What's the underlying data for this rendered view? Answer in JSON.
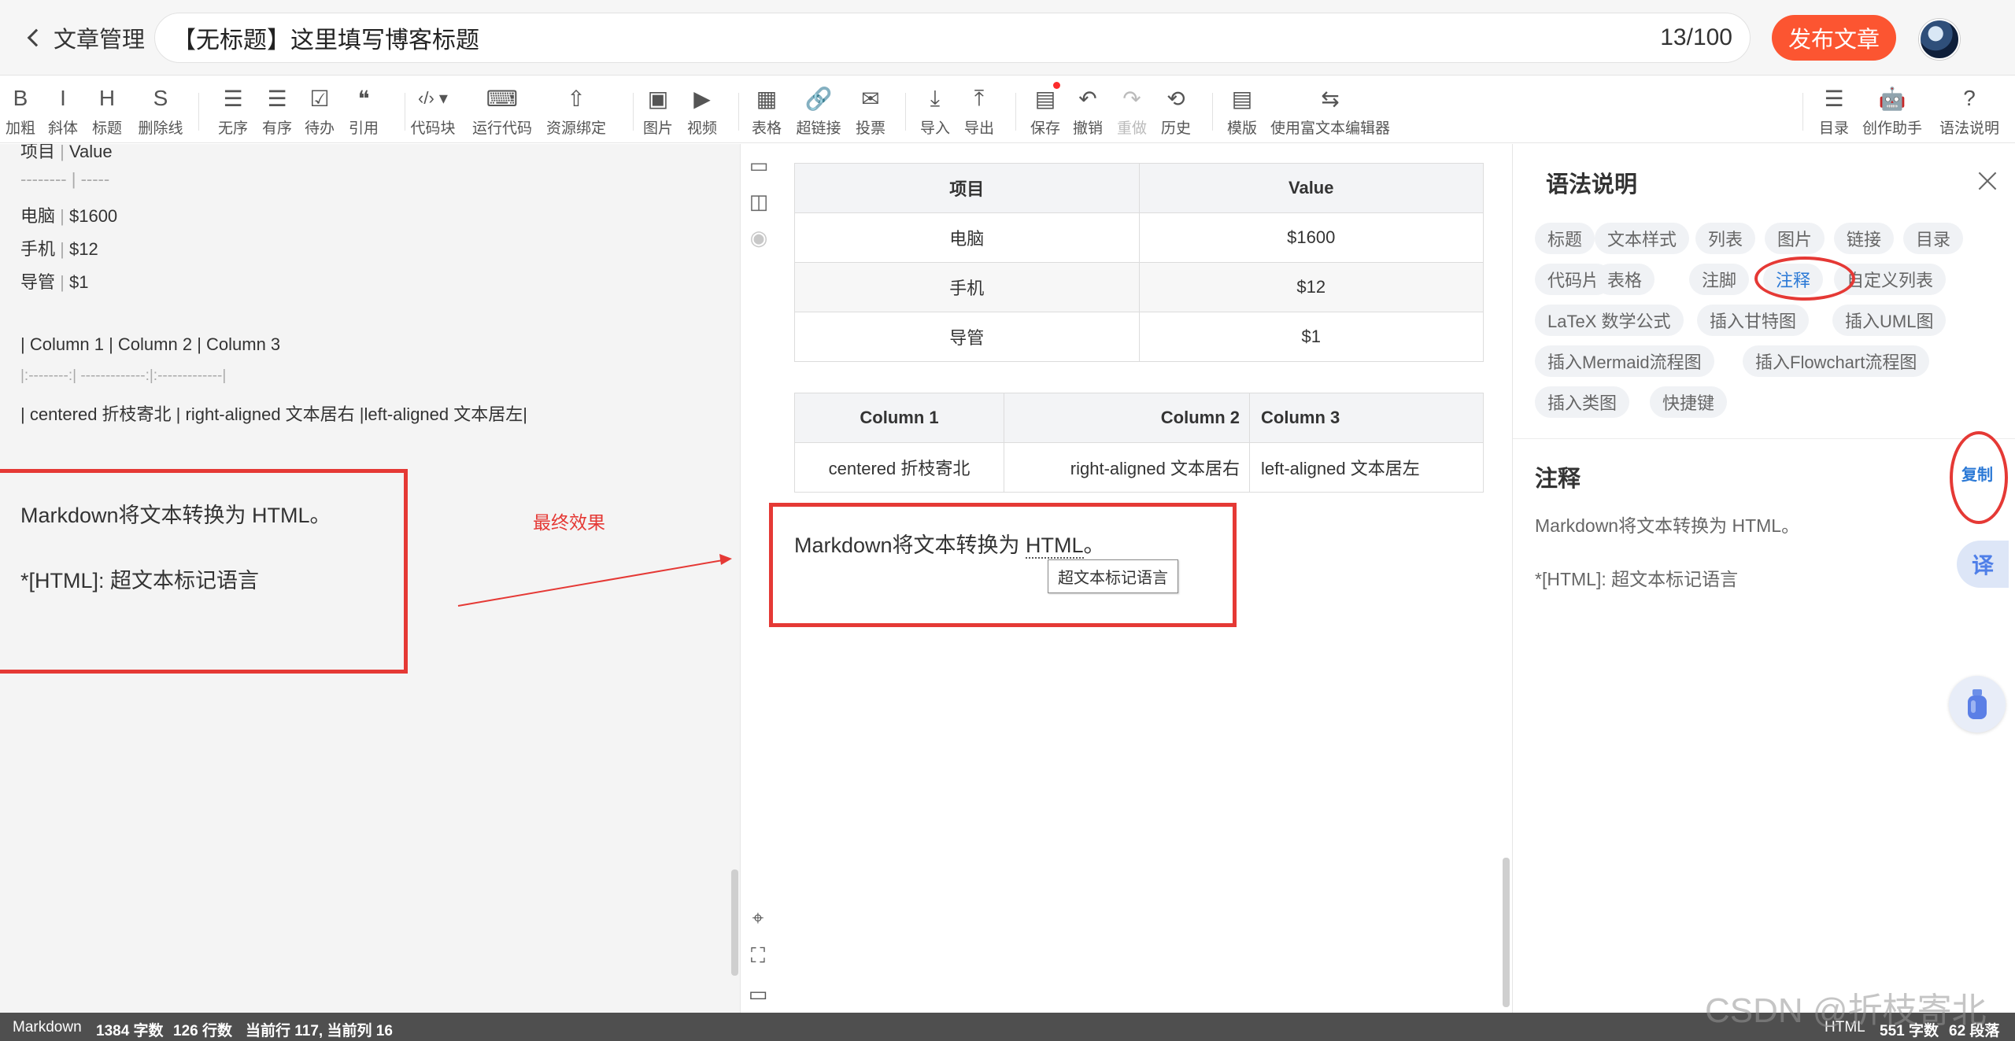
{
  "header": {
    "back_label": "文章管理",
    "title_value": "【无标题】这里填写博客标题",
    "title_count": "13/100",
    "publish_label": "发布文章"
  },
  "toolbar": {
    "items": [
      {
        "icon": "B",
        "label": "加粗",
        "icon_name": "bold-icon"
      },
      {
        "icon": "I",
        "label": "斜体",
        "icon_name": "italic-icon"
      },
      {
        "icon": "H",
        "label": "标题",
        "icon_name": "heading-icon"
      },
      {
        "icon": "S",
        "label": "删除线",
        "icon_name": "strikethrough-icon"
      },
      {
        "icon": "☰",
        "label": "无序",
        "icon_name": "unordered-list-icon"
      },
      {
        "icon": "☰",
        "label": "有序",
        "icon_name": "ordered-list-icon"
      },
      {
        "icon": "☑",
        "label": "待办",
        "icon_name": "todo-list-icon"
      },
      {
        "icon": "❝",
        "label": "引用",
        "icon_name": "quote-icon"
      },
      {
        "icon": "‹/›",
        "label": "代码块",
        "icon_name": "code-block-icon"
      },
      {
        "icon": "⌨",
        "label": "运行代码",
        "icon_name": "run-code-icon"
      },
      {
        "icon": "⇧",
        "label": "资源绑定",
        "icon_name": "resource-bind-icon"
      },
      {
        "icon": "▣",
        "label": "图片",
        "icon_name": "image-icon"
      },
      {
        "icon": "▶",
        "label": "视频",
        "icon_name": "video-icon"
      },
      {
        "icon": "▦",
        "label": "表格",
        "icon_name": "table-icon"
      },
      {
        "icon": "🔗",
        "label": "超链接",
        "icon_name": "link-icon"
      },
      {
        "icon": "✉",
        "label": "投票",
        "icon_name": "vote-icon"
      },
      {
        "icon": "⤓",
        "label": "导入",
        "icon_name": "import-icon"
      },
      {
        "icon": "⤒",
        "label": "导出",
        "icon_name": "export-icon"
      },
      {
        "icon": "▤",
        "label": "保存",
        "icon_name": "save-icon"
      },
      {
        "icon": "↶",
        "label": "撤销",
        "icon_name": "undo-icon"
      },
      {
        "icon": "↷",
        "label": "重做",
        "icon_name": "redo-icon"
      },
      {
        "icon": "⟲",
        "label": "历史",
        "icon_name": "history-icon"
      },
      {
        "icon": "▤",
        "label": "模版",
        "icon_name": "template-icon"
      },
      {
        "icon": "⇆",
        "label": "使用富文本编辑器",
        "icon_name": "rich-text-switch-icon"
      },
      {
        "icon": "☰",
        "label": "目录",
        "icon_name": "toc-icon"
      },
      {
        "icon": "🤖",
        "label": "创作助手",
        "icon_name": "assistant-icon"
      },
      {
        "icon": "?",
        "label": "语法说明",
        "icon_name": "syntax-help-icon"
      }
    ]
  },
  "editor": {
    "lines": [
      {
        "left": "项目",
        "right": "Value"
      },
      {
        "left": "--------",
        "right": "-----"
      },
      {
        "left": "电脑",
        "right": "$1600"
      },
      {
        "left": "手机",
        "right": "$12"
      },
      {
        "left": "导管",
        "right": "$1"
      }
    ],
    "table2_header": "| Column 1 | Column 2      | Column 3",
    "table2_align": "|:--------:| -------------:|:-------------|",
    "table2_row": "| centered 折枝寄北 | right-aligned 文本居右 |left-aligned 文本居左|",
    "abbr_line1": "Markdown将文本转换为 HTML。",
    "abbr_line2_prefix": "*[",
    "abbr_line2_term": "HTML",
    "abbr_line2_rest": "]:   超文本标记语言",
    "annotation": "最终效果"
  },
  "preview": {
    "table1": {
      "headers": [
        "项目",
        "Value"
      ],
      "rows": [
        [
          "电脑",
          "$1600"
        ],
        [
          "手机",
          "$12"
        ],
        [
          "导管",
          "$1"
        ]
      ]
    },
    "table2": {
      "headers": [
        "Column 1",
        "Column 2",
        "Column 3"
      ],
      "rows": [
        [
          "centered 折枝寄北",
          "right-aligned 文本居右",
          "left-aligned 文本居左"
        ]
      ]
    },
    "abbr_text_before": "Markdown将文本转换为 ",
    "abbr_term": "HTML",
    "abbr_text_after": "。",
    "tooltip": "超文本标记语言"
  },
  "help": {
    "title": "语法说明",
    "chips": [
      "标题",
      "文本样式",
      "列表",
      "图片",
      "链接",
      "目录",
      "代码片",
      "表格",
      "注脚",
      "注释",
      "自定义列表",
      "LaTeX 数学公式",
      "插入甘特图",
      "插入UML图",
      "插入Mermaid流程图",
      "插入Flowchart流程图",
      "插入类图",
      "快捷键"
    ],
    "active_chip": "注释",
    "section_title": "注释",
    "copy_label": "复制",
    "line1": "Markdown将文本转换为 HTML。",
    "line2": "*[HTML]:   超文本标记语言",
    "translate_label": "译"
  },
  "status": {
    "mode": "Markdown",
    "chars": "1384 字数",
    "lines": "126 行数",
    "cursor": "当前行 117, 当前列 16",
    "right_mode": "HTML",
    "right_chars": "551 字数",
    "right_paras": "62 段落"
  },
  "watermark": "CSDN @折枝寄北",
  "colors": {
    "accent": "#fc5531",
    "link": "#2b79d6",
    "annotation_red": "#e53935",
    "status_bg": "#4f4f4f"
  }
}
